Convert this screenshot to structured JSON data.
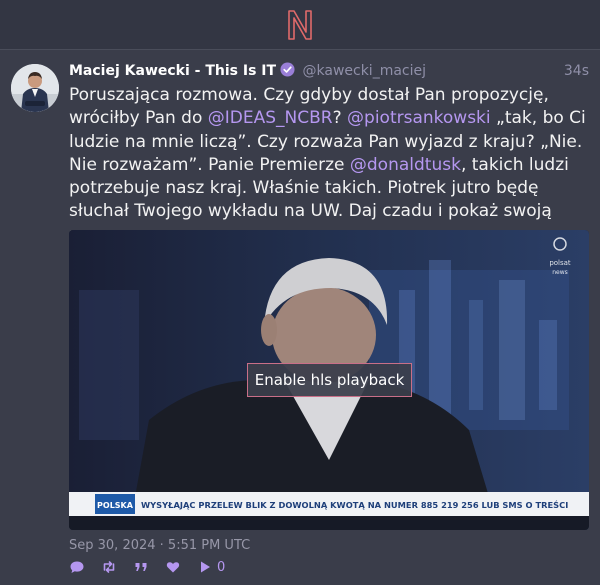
{
  "app": {
    "logo_letter": "N",
    "accent": "#b597f0",
    "logo_color": "#e06a6a"
  },
  "tweet": {
    "fullname": "Maciej Kawecki - This Is IT",
    "handle": "@kawecki_maciej",
    "time": "34s",
    "content": {
      "part1": "Poruszająca rozmowa. Czy gdyby dostał Pan propozycję, wróciłby Pan do ",
      "mention1": "@IDEAS_NCBR",
      "part2": "? ",
      "mention2": "@piotrsankowski",
      "part3": " „tak, bo Ci ludzie na mnie liczą”. Czy rozważa Pan wyjazd z kraju? „Nie. Nie rozważam”. Panie Premierze ",
      "mention3": "@donaldtusk",
      "part4": ", takich ludzi potrzebuje nasz kraj. Właśnie takich. Piotrek jutro będę słuchał Twojego wykładu na UW. Daj czadu i pokaż swoją moc."
    },
    "media": {
      "button_label": "Enable hls playback",
      "ticker_label": "POLSKA",
      "ticker_text": "WYSYŁAJĄC PRZELEW BLIK Z DOWOLNĄ KWOTĄ NA NUMER 885 219 256 LUB SMS O TREŚCI",
      "channel_logo_line1": "polsat",
      "channel_logo_line2": "news"
    },
    "date": "Sep 30, 2024 · 5:51 PM UTC",
    "stats": {
      "replies": "",
      "retweets": "",
      "quotes": "",
      "likes": "",
      "views": "0"
    }
  }
}
